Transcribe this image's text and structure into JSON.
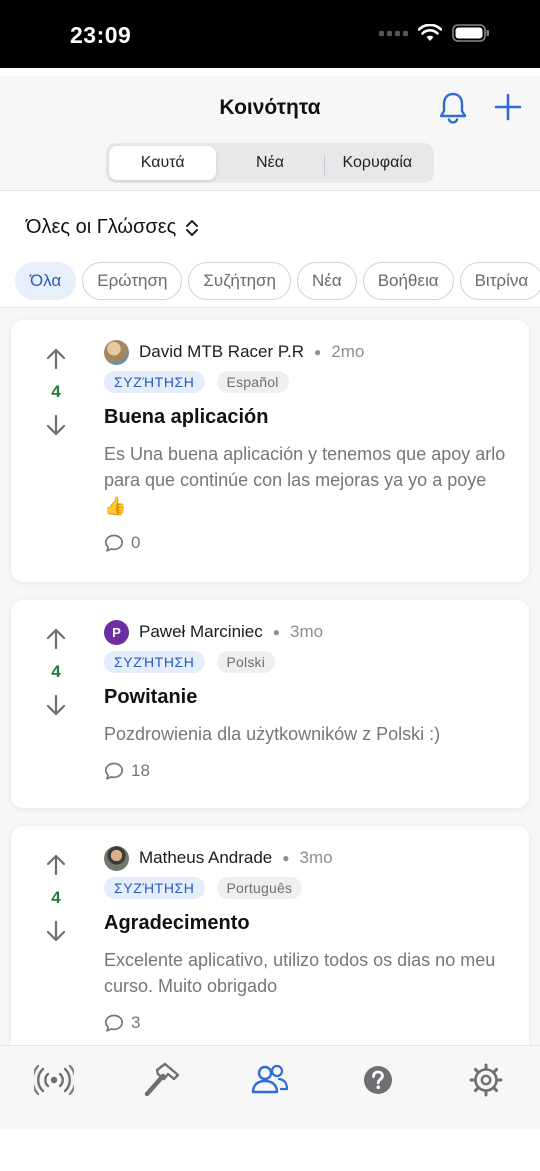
{
  "status_bar": {
    "time": "23:09"
  },
  "header": {
    "title": "Κοινότητα",
    "segments": [
      "Καυτά",
      "Νέα",
      "Κορυφαία"
    ],
    "active_segment": "Καυτά"
  },
  "language_filter": {
    "label": "Όλες οι Γλώσσες"
  },
  "categories": {
    "items": [
      "Όλα",
      "Ερώτηση",
      "Συζήτηση",
      "Νέα",
      "Βοήθεια",
      "Βιτρίνα"
    ],
    "active": "Όλα"
  },
  "posts": [
    {
      "author": "David MTB Racer P.R",
      "time": "2mo",
      "type": "ΣΥΖΉΤΗΣΗ",
      "language": "Español",
      "title": "Buena aplicación",
      "body": "Es Una buena aplicación y tenemos que apoy arlo para que continúe con las mejoras ya yo a poye 👍",
      "votes": "4",
      "comments": "0",
      "avatar_color": "#a5875f"
    },
    {
      "author": "Paweł Marciniec",
      "time": "3mo",
      "type": "ΣΥΖΉΤΗΣΗ",
      "language": "Polski",
      "title": "Powitanie",
      "body": "Pozdrowienia dla użytkowników z Polski :)",
      "votes": "4",
      "comments": "18",
      "avatar_letter": "P",
      "avatar_color": "#6b2fa3"
    },
    {
      "author": "Matheus Andrade",
      "time": "3mo",
      "type": "ΣΥΖΉΤΗΣΗ",
      "language": "Português",
      "title": "Agradecimento",
      "body": "Excelente aplicativo, utilizo todos os dias no meu curso. Muito obrigado",
      "votes": "4",
      "comments": "3",
      "avatar_color": "#6f7a6a"
    }
  ],
  "tab_bar": {
    "items": [
      "broadcast-icon",
      "hammer-icon",
      "community-icon",
      "help-icon",
      "settings-icon"
    ],
    "active": "community-icon"
  },
  "colors": {
    "accent": "#2f6bd9",
    "vote_green": "#1e7c3c",
    "tag_blue_bg": "#e3edfb"
  }
}
